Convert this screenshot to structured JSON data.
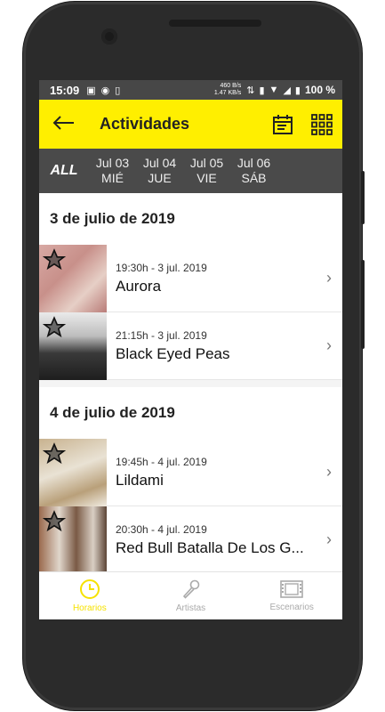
{
  "status_bar": {
    "time": "15:09",
    "net_up": "460 B/s",
    "net_down": "1.47 KB/s",
    "battery": "100 %"
  },
  "toolbar": {
    "title": "Actividades",
    "back_icon": "arrow-left-icon",
    "calendar_icon": "calendar-icon",
    "grid_icon": "grid-icon",
    "accent": "#ffef00"
  },
  "day_filter": {
    "all_label": "ALL",
    "days": [
      {
        "date": "Jul 03",
        "weekday": "MIÉ"
      },
      {
        "date": "Jul 04",
        "weekday": "JUE"
      },
      {
        "date": "Jul 05",
        "weekday": "VIE"
      },
      {
        "date": "Jul 06",
        "weekday": "SÁB"
      }
    ]
  },
  "sections": [
    {
      "title": "3 de julio de 2019",
      "items": [
        {
          "time": "19:30h - 3 jul. 2019",
          "name": "Aurora"
        },
        {
          "time": "21:15h - 3 jul. 2019",
          "name": "Black Eyed Peas"
        }
      ]
    },
    {
      "title": "4 de julio de 2019",
      "items": [
        {
          "time": "19:45h - 4 jul. 2019",
          "name": "Lildami"
        },
        {
          "time": "20:30h - 4 jul. 2019",
          "name": "Red Bull Batalla De Los G..."
        }
      ]
    }
  ],
  "bottom_nav": {
    "items": [
      {
        "label": "Horarios",
        "icon": "clock-icon",
        "active": true
      },
      {
        "label": "Artistas",
        "icon": "microphone-icon",
        "active": false
      },
      {
        "label": "Escenarios",
        "icon": "film-icon",
        "active": false
      }
    ]
  }
}
